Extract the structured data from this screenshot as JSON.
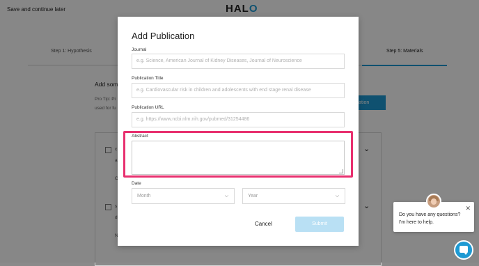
{
  "header": {
    "save_later": "Save and continue later",
    "logo": "HALO"
  },
  "steps": {
    "step1": "Step 1: Hypothesis",
    "step5": "Step 5: Materials"
  },
  "background": {
    "add_some": "Add some",
    "pro_tip": "Pro Tip: Pi used for fu",
    "blue_button": "ication",
    "row1_a": "c",
    "row1_b": "a",
    "row1_c": "C",
    "row2_a": "s",
    "row2_b": "d",
    "row2_c": "N"
  },
  "modal": {
    "title": "Add Publication",
    "journal": {
      "label": "Journal",
      "placeholder": "e.g. Science, American Journal of Kidney Diseases, Journal of Neuroscience"
    },
    "pub_title": {
      "label": "Publication Title",
      "placeholder": "e.g. Cardiovascular risk in children and adolescents with end stage renal disease"
    },
    "pub_url": {
      "label": "Publication URL",
      "placeholder": "e.g. https://www.ncbi.nlm.nih.gov/pubmed/31254486"
    },
    "abstract": {
      "label": "Abstract",
      "value": ""
    },
    "date": {
      "label": "Date",
      "month": "Month",
      "year": "Year"
    },
    "cancel": "Cancel",
    "submit": "Submit"
  },
  "chat": {
    "message": "Do you have any questions? I'm here to help."
  },
  "colors": {
    "accent": "#1e9ad3",
    "highlight": "#e8306f",
    "submit_disabled": "#b9e0f4"
  }
}
